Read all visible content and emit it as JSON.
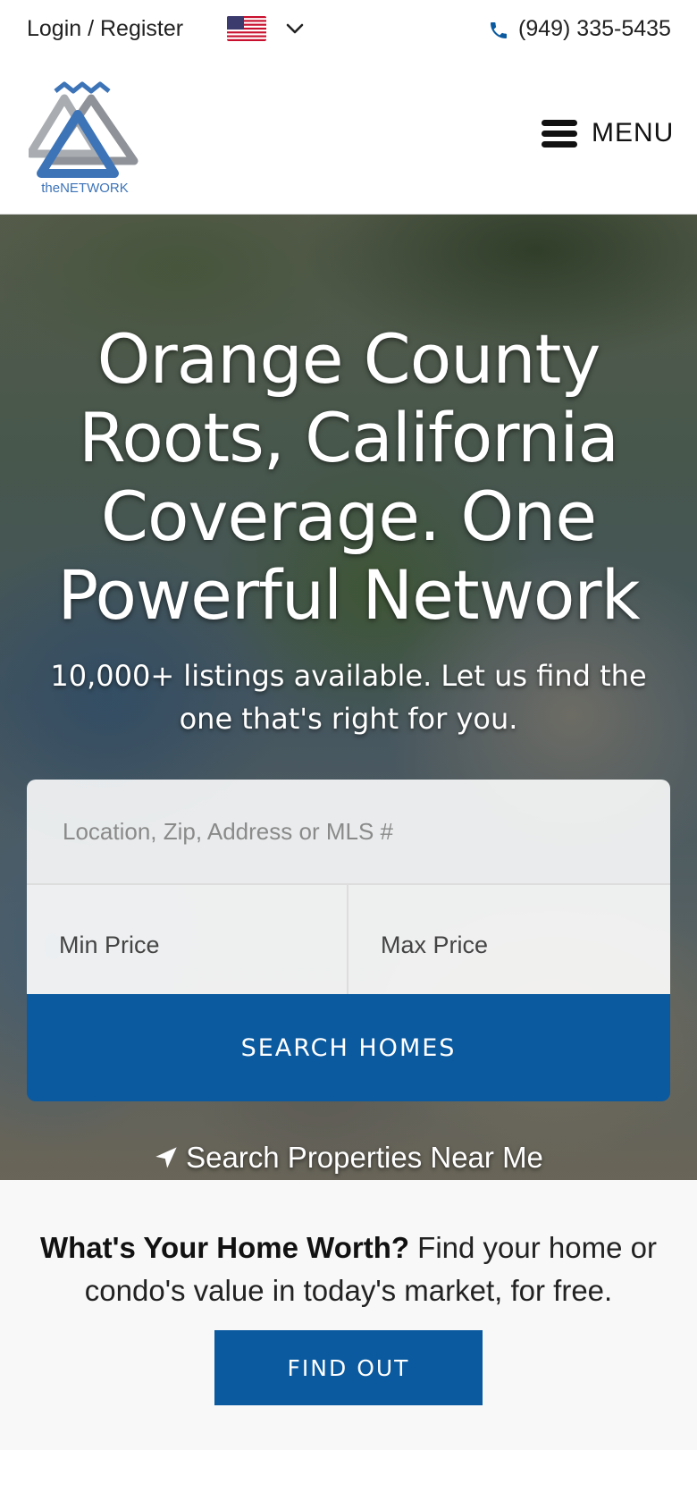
{
  "topbar": {
    "login_label": "Login / Register",
    "flag_icon": "us-flag-icon",
    "phone": "(949) 335-5435"
  },
  "header": {
    "logo_text": "theNETWORK",
    "menu_label": "MENU"
  },
  "hero": {
    "title": "Orange County Roots, California Coverage. One Powerful Network",
    "subtitle": "10,000+ listings available. Let us find the one that's right for you.",
    "search": {
      "location_placeholder": "Location, Zip, Address or MLS #",
      "min_price": "Min Price",
      "max_price": "Max Price",
      "button_label": "SEARCH HOMES"
    },
    "near_me_label": "Search Properties Near Me"
  },
  "worth": {
    "heading": "What's Your Home Worth?",
    "text": " Find your home or condo's value in today's market, for free.",
    "button_label": "FIND OUT"
  },
  "colors": {
    "accent": "#0b5aa0",
    "phone_icon": "#0b5aa0"
  }
}
